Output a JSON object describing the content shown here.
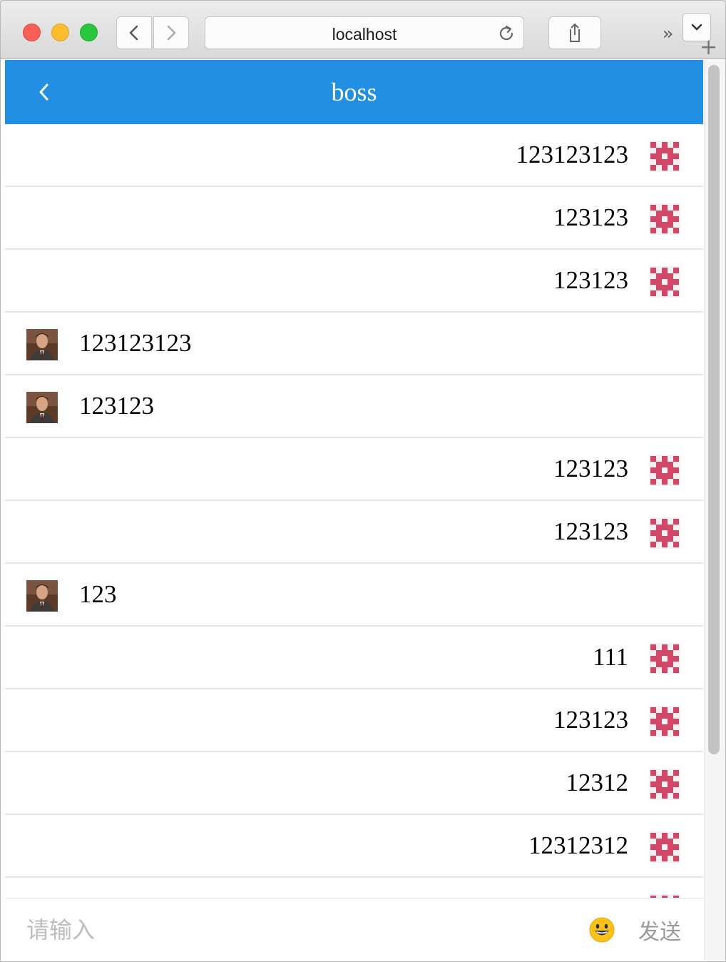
{
  "browser": {
    "url": "localhost"
  },
  "header": {
    "title": "boss"
  },
  "messages": [
    {
      "side": "mine",
      "text": "123123123"
    },
    {
      "side": "mine",
      "text": "123123"
    },
    {
      "side": "mine",
      "text": "123123"
    },
    {
      "side": "other",
      "text": "123123123"
    },
    {
      "side": "other",
      "text": "123123"
    },
    {
      "side": "mine",
      "text": "123123"
    },
    {
      "side": "mine",
      "text": "123123"
    },
    {
      "side": "other",
      "text": "123"
    },
    {
      "side": "mine",
      "text": "111"
    },
    {
      "side": "mine",
      "text": "123123"
    },
    {
      "side": "mine",
      "text": "12312"
    },
    {
      "side": "mine",
      "text": "12312312"
    },
    {
      "side": "mine",
      "text": ""
    }
  ],
  "input": {
    "placeholder": "请输入",
    "value": ""
  },
  "send_label": "发送",
  "colors": {
    "header_bg": "#228fe3",
    "identicon": "#d4456a",
    "divider": "#e6e6e6"
  },
  "icons": {
    "back": "chevron-left-icon",
    "emoji": "smiley-emoji-icon",
    "my_avatar": "identicon-avatar",
    "other_avatar": "portrait-avatar"
  }
}
